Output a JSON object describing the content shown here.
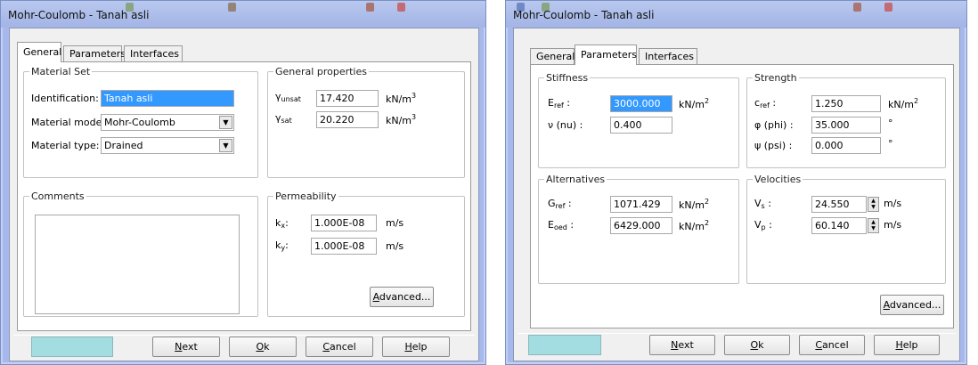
{
  "colors": {
    "frame": "#a7b8ec",
    "color_box": "#a3dde1",
    "selection": "#3399ff"
  },
  "win1": {
    "title": "Mohr-Coulomb - Tanah asli",
    "tabs": [
      "General",
      "Parameters",
      "Interfaces"
    ],
    "material_set": {
      "legend": "Material Set",
      "identification_label": "Identification:",
      "identification_value": "Tanah asli",
      "model_label": "Material model:",
      "model_value": "Mohr-Coulomb",
      "type_label": "Material type:",
      "type_value": "Drained"
    },
    "general_properties": {
      "legend": "General properties",
      "gamma_symbol": "γ",
      "gamma_unsat_sub": "unsat",
      "gamma_unsat_value": "17.420",
      "gamma_sat_sub": "sat",
      "gamma_sat_value": "20.220",
      "unit": "kN/m",
      "unit_exp": "3"
    },
    "comments": {
      "legend": "Comments"
    },
    "permeability": {
      "legend": "Permeability",
      "kx_label": "k",
      "kx_sub": "x",
      "kx_value": "1.000E-08",
      "ky_label": "k",
      "ky_sub": "y",
      "ky_value": "1.000E-08",
      "unit": "m/s",
      "advanced_pre": "",
      "advanced_ul": "A",
      "advanced_post": "dvanced..."
    },
    "buttons": {
      "next_ul": "N",
      "next_rest": "ext",
      "ok_ul": "O",
      "ok_rest": "k",
      "cancel_ul": "C",
      "cancel_rest": "ancel",
      "help_ul": "H",
      "help_rest": "elp"
    }
  },
  "win2": {
    "title": "Mohr-Coulomb - Tanah asli",
    "tabs": [
      "General",
      "Parameters",
      "Interfaces"
    ],
    "stiffness": {
      "legend": "Stiffness",
      "eref_label": "E",
      "eref_sub": "ref",
      "eref_value": "3000.000",
      "nu_label": "ν (nu) :",
      "nu_value": "0.400",
      "unit": "kN/m",
      "unit_exp": "2"
    },
    "strength": {
      "legend": "Strength",
      "cref_label": "c",
      "cref_sub": "ref",
      "cref_value": "1.250",
      "cref_unit": "kN/m",
      "cref_unit_exp": "2",
      "phi_label": "φ (phi) :",
      "phi_value": "35.000",
      "psi_label": "ψ (psi) :",
      "psi_value": "0.000",
      "deg_unit": "°"
    },
    "alternatives": {
      "legend": "Alternatives",
      "gref_label": "G",
      "gref_sub": "ref",
      "gref_value": "1071.429",
      "eoed_label": "E",
      "eoed_sub": "oed",
      "eoed_value": "6429.000",
      "unit": "kN/m",
      "unit_exp": "2"
    },
    "velocities": {
      "legend": "Velocities",
      "vs_label": "V",
      "vs_sub": "s",
      "vs_value": "24.550",
      "vp_label": "V",
      "vp_sub": "p",
      "vp_value": "60.140",
      "unit": "m/s"
    },
    "advanced_ul": "A",
    "advanced_post": "dvanced...",
    "buttons": {
      "next_ul": "N",
      "next_rest": "ext",
      "ok_ul": "O",
      "ok_rest": "k",
      "cancel_ul": "C",
      "cancel_rest": "ancel",
      "help_ul": "H",
      "help_rest": "elp"
    }
  }
}
